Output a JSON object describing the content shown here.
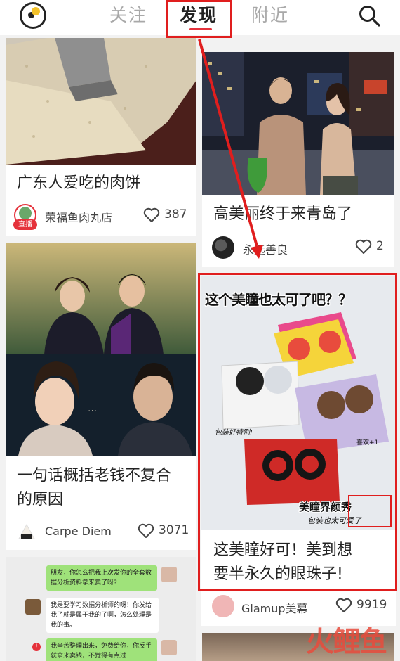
{
  "header": {
    "tabs": [
      "关注",
      "发现",
      "附近"
    ],
    "active_tab": "发现"
  },
  "cards": {
    "meatpie": {
      "title": "广东人爱吃的肉饼",
      "author": "荣福鱼肉丸店",
      "live_badge": "直播",
      "likes": "387"
    },
    "qingdao": {
      "title": "高美丽终于来青岛了",
      "author": "永远善良",
      "likes": "2"
    },
    "oldmoney": {
      "title_line1": "一句话概括老钱不复合",
      "title_line2": "的原因",
      "author": "Carpe Diem",
      "likes": "3071"
    },
    "lens": {
      "banner": "这个美瞳也太可了吧？？",
      "title_line1": "这美瞳好可！美到想",
      "title_line2": "要半永久的眼珠子!",
      "author": "Glamup美幕",
      "likes": "9919",
      "caption_brand": "美瞳界颜秀",
      "caption_sub": "包装也太可爱了",
      "caption_left": "包装好特别!",
      "caption_right": "喜欢+1"
    },
    "chat": {
      "msg1": "朋友，你怎么把我上次发你的全套数据分析资料拿来卖了呀?",
      "msg2": "我是要学习数据分析师的呀！你发给我了就是属于我的了啊，怎么处理是我的事。",
      "msg3": "我辛苦整理出来，免费给你，你反手就拿来卖钱，不觉得有点过"
    }
  },
  "watermark": "火鲤鱼",
  "colors": {
    "accent": "#e5323b",
    "annotation": "#e01e1e"
  }
}
